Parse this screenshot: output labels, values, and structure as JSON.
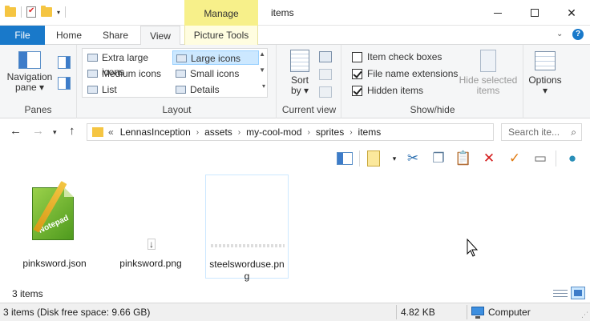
{
  "window": {
    "title": "items",
    "manage_tab": "Manage"
  },
  "tabs": {
    "file": "File",
    "home": "Home",
    "share": "Share",
    "view": "View",
    "picture": "Picture Tools"
  },
  "ribbon": {
    "panes": {
      "nav_pane_line1": "Navigation",
      "nav_pane_line2": "pane ▾",
      "label": "Panes"
    },
    "layout": {
      "items": {
        "extra_large": "Extra large icons",
        "large": "Large icons",
        "medium": "Medium icons",
        "small": "Small icons",
        "list": "List",
        "details": "Details"
      },
      "selected": "Large icons",
      "label": "Layout"
    },
    "current_view": {
      "sort_line1": "Sort",
      "sort_line2": "by ▾",
      "label": "Current view"
    },
    "show_hide": {
      "item_check_boxes": "Item check boxes",
      "file_name_extensions": "File name extensions",
      "hidden_items": "Hidden items",
      "item_check_boxes_checked": false,
      "file_name_extensions_checked": true,
      "hidden_items_checked": true,
      "hide_selected_line1": "Hide selected",
      "hide_selected_line2": "items",
      "label": "Show/hide"
    },
    "options": {
      "label_line1": "Options",
      "label_line2": "▾"
    }
  },
  "address": {
    "lead": "«",
    "crumbs": [
      "LennasInception",
      "assets",
      "my-cool-mod",
      "sprites",
      "items"
    ],
    "search_placeholder": "Search ite..."
  },
  "files": [
    {
      "name_line1": "pinksword.json",
      "name_line2": "",
      "type": "json"
    },
    {
      "name_line1": "pinksword.png",
      "name_line2": "",
      "type": "png"
    },
    {
      "name_line1": "steelsworduse.pn",
      "name_line2": "g",
      "type": "png",
      "selected": true
    }
  ],
  "status": {
    "item_count": "3 items",
    "disk_info": "3 items (Disk free space: 9.66 GB)",
    "size": "4.82 KB",
    "location": "Computer"
  },
  "colors": {
    "file_tab": "#1979ca",
    "manage_tab": "#f7f08a",
    "selection": "#cce8ff"
  }
}
